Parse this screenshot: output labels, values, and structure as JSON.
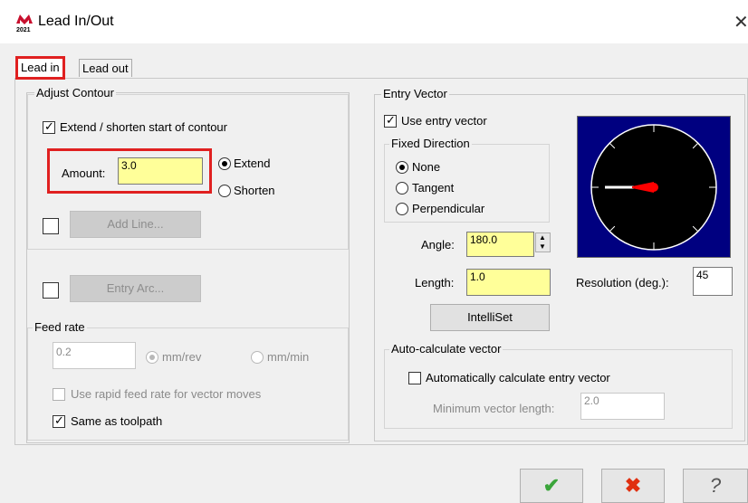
{
  "window": {
    "title": "Lead In/Out",
    "logo_text": "2021"
  },
  "tabs": [
    {
      "label": "Lead in"
    },
    {
      "label": "Lead out"
    }
  ],
  "adjust_contour": {
    "legend": "Adjust Contour",
    "extend_shorten_label": "Extend / shorten start of contour",
    "extend_shorten_checked": true,
    "amount_label": "Amount:",
    "amount_value": "3.0",
    "mode_extend": "Extend",
    "mode_shorten": "Shorten",
    "mode_selected": "Extend",
    "add_line_label": "Add Line...",
    "add_line_checked": false
  },
  "entry_arc": {
    "label": "Entry Arc...",
    "checked": false
  },
  "feed_rate": {
    "legend": "Feed rate",
    "value": "0.2",
    "unit_rev": "mm/rev",
    "unit_min": "mm/min",
    "unit_selected": "mm/rev",
    "rapid_label": "Use rapid feed rate for vector moves",
    "rapid_checked": false,
    "same_label": "Same as toolpath",
    "same_checked": true
  },
  "entry_vector": {
    "legend": "Entry Vector",
    "use_label": "Use entry vector",
    "use_checked": true,
    "fixed_direction": {
      "legend": "Fixed Direction",
      "options": [
        "None",
        "Tangent",
        "Perpendicular"
      ],
      "selected": "None"
    },
    "angle_label": "Angle:",
    "angle_value": "180.0",
    "length_label": "Length:",
    "length_value": "1.0",
    "intelliset_label": "IntelliSet",
    "resolution_label": "Resolution (deg.):",
    "resolution_value": "45",
    "dial_angle_deg": 180
  },
  "auto_calc": {
    "legend": "Auto-calculate vector",
    "auto_label": "Automatically calculate entry vector",
    "auto_checked": false,
    "min_length_label": "Minimum vector length:",
    "min_length_value": "2.0"
  },
  "footer": {
    "ok_icon": "green-checkmark-icon",
    "cancel_icon": "red-x-icon",
    "help_icon": "question-mark-icon"
  },
  "colors": {
    "highlight_red": "#e02020",
    "input_yellow": "#ffff99",
    "dial_bg": "#000080",
    "ok_green": "#3aa53a",
    "cancel_red": "#e03010"
  }
}
